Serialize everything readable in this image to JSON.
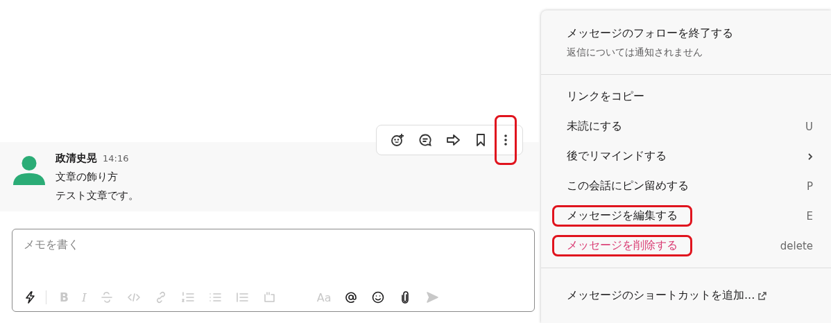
{
  "message_actions": [
    {
      "kind": "emoji-add",
      "highlighted": false
    },
    {
      "kind": "thread",
      "highlighted": false
    },
    {
      "kind": "forward",
      "highlighted": false
    },
    {
      "kind": "bookmark",
      "highlighted": false
    },
    {
      "kind": "more",
      "highlighted": true
    }
  ],
  "message": {
    "author": "政清史晃",
    "time": "14:16",
    "lines": [
      "文章の飾り方",
      "テスト文章です。"
    ]
  },
  "composer": {
    "placeholder": "メモを書く",
    "tools": [
      {
        "kind": "shortcut",
        "disabled": false
      },
      {
        "kind": "bold",
        "label": "B",
        "disabled": true
      },
      {
        "kind": "italic",
        "label": "I",
        "disabled": true
      },
      {
        "kind": "strike",
        "disabled": true
      },
      {
        "kind": "code",
        "disabled": true
      },
      {
        "kind": "link",
        "disabled": true
      },
      {
        "kind": "ordered-list",
        "disabled": true
      },
      {
        "kind": "bullet-list",
        "disabled": true
      },
      {
        "kind": "quote",
        "disabled": true
      },
      {
        "kind": "code-block",
        "disabled": true
      },
      {
        "kind": "format",
        "label": "Aa",
        "disabled": true
      },
      {
        "kind": "mention",
        "disabled": false
      },
      {
        "kind": "emoji",
        "disabled": false
      },
      {
        "kind": "attach",
        "disabled": false
      },
      {
        "kind": "send",
        "disabled": true
      }
    ]
  },
  "menu": {
    "sections": [
      [
        {
          "kind": "header",
          "label": "メッセージのフォローを終了する",
          "subtitle": "返信については通知されません"
        }
      ],
      [
        {
          "kind": "item",
          "label": "リンクをコピー",
          "highlighted": false
        },
        {
          "kind": "item",
          "label": "未読にする",
          "shortcut": "U",
          "highlighted": false
        },
        {
          "kind": "submenu",
          "label": "後でリマインドする",
          "highlighted": false
        },
        {
          "kind": "item",
          "label": "この会話にピン留めする",
          "shortcut": "P",
          "highlighted": false
        },
        {
          "kind": "item",
          "label": "メッセージを編集する",
          "shortcut": "E",
          "highlighted": true
        },
        {
          "kind": "danger",
          "label": "メッセージを削除する",
          "shortcut": "delete",
          "highlighted": true
        }
      ],
      [
        {
          "kind": "external",
          "label": "メッセージのショートカットを追加...",
          "highlighted": false
        }
      ]
    ]
  }
}
